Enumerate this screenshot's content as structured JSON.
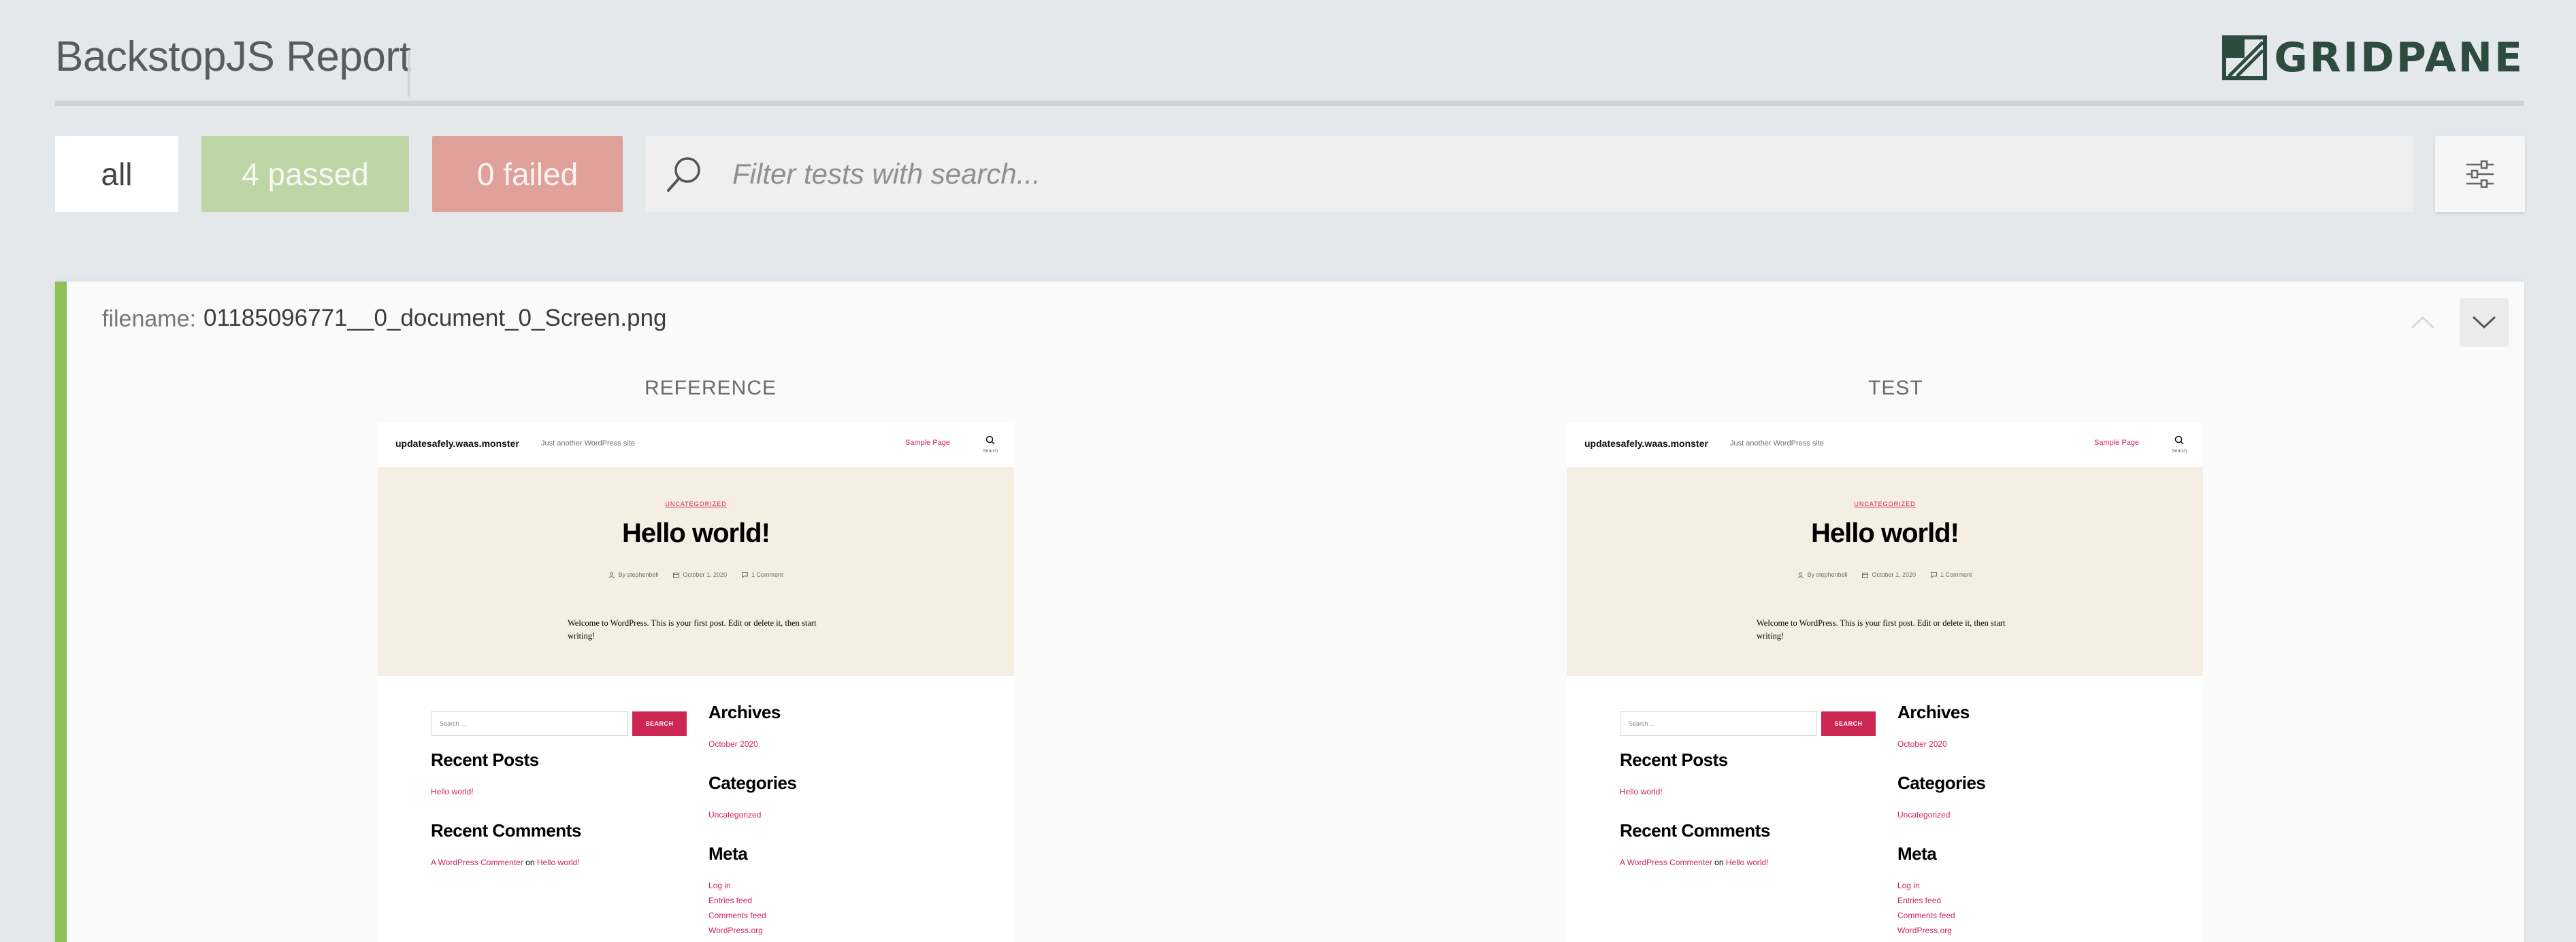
{
  "header": {
    "title": "BackstopJS Report",
    "logo_text": "GRIDPANE"
  },
  "toolbar": {
    "all_label": "all",
    "passed_label": "4 passed",
    "failed_label": "0 failed",
    "search_placeholder": "Filter tests with search..."
  },
  "colors": {
    "passed": "#bed6a6",
    "failed": "#e0a19b",
    "status_pass": "#8cc158",
    "link": "#cd2653"
  },
  "test": {
    "filename_label": "filename:",
    "filename": "01185096771__0_document_0_Screen.png",
    "reference_label": "REFERENCE",
    "test_label": "TEST"
  },
  "site": {
    "title": "updatesafely.waas.monster",
    "description": "Just another WordPress site",
    "menu_item": "Sample Page",
    "search_label": "Search",
    "category": "UNCATEGORIZED",
    "post_title": "Hello world!",
    "meta_author": "By stephenbell",
    "meta_date": "October 1, 2020",
    "meta_comments": "1 Comment",
    "excerpt": "Welcome to WordPress. This is your first post. Edit or delete it, then start writing!",
    "search_placeholder": "Search ...",
    "search_button": "SEARCH",
    "recent_posts_heading": "Recent Posts",
    "recent_post_link": "Hello world!",
    "recent_comments_heading": "Recent Comments",
    "comment_author": "A WordPress Commenter",
    "comment_on": "on",
    "comment_post": "Hello world!",
    "archives_heading": "Archives",
    "archive_link": "October 2020",
    "categories_heading": "Categories",
    "category_link": "Uncategorized",
    "meta_heading": "Meta",
    "meta_links": [
      "Log in",
      "Entries feed",
      "Comments feed",
      "WordPress.org"
    ]
  }
}
